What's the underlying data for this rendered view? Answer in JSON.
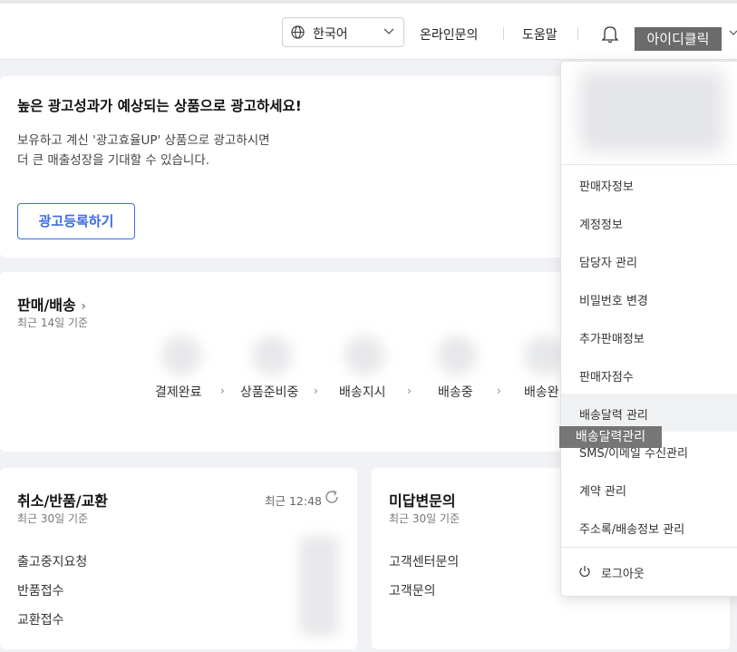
{
  "header": {
    "language": "한국어",
    "links": [
      "온라인문의",
      "도움말"
    ],
    "user_label": "아이디클릭"
  },
  "promo": {
    "title": "높은 광고성과가 예상되는 상품으로 광고하세요!",
    "line1": "보유하고 계신 '광고효율UP' 상품으로 광고하시면",
    "line2": "더 큰 매출성장을 기대할 수 있습니다.",
    "button": "광고등록하기"
  },
  "sales": {
    "title": "판매/배송",
    "subtitle": "최근 14일 기준",
    "stages": [
      "결제완료",
      "상품준비중",
      "배송지시",
      "배송중",
      "배송완"
    ]
  },
  "cancel": {
    "title": "취소/반품/교환",
    "subtitle": "최근 30일 기준",
    "recent": "최근 12:48",
    "items": [
      "출고중지요청",
      "반품접수",
      "교환접수"
    ]
  },
  "unanswered": {
    "title": "미답변문의",
    "subtitle": "최근 30일 기준",
    "items": [
      "고객센터문의",
      "고객문의"
    ]
  },
  "menu": {
    "items": [
      "판매자정보",
      "계정정보",
      "담당자 관리",
      "비밀번호 변경",
      "추가판매정보",
      "판매자점수",
      "배송달력 관리",
      "SMS/이메일 수신관리",
      "계약 관리",
      "주소록/배송정보 관리"
    ],
    "logout": "로그아웃",
    "tooltip": "배송달력관리"
  },
  "icons": {
    "language": "globe-icon",
    "notifications": "bell-icon",
    "refresh": "refresh-icon",
    "logout": "power-icon"
  },
  "colors": {
    "accent": "#3d6ce3",
    "label_bg": "#6b6b6b"
  }
}
